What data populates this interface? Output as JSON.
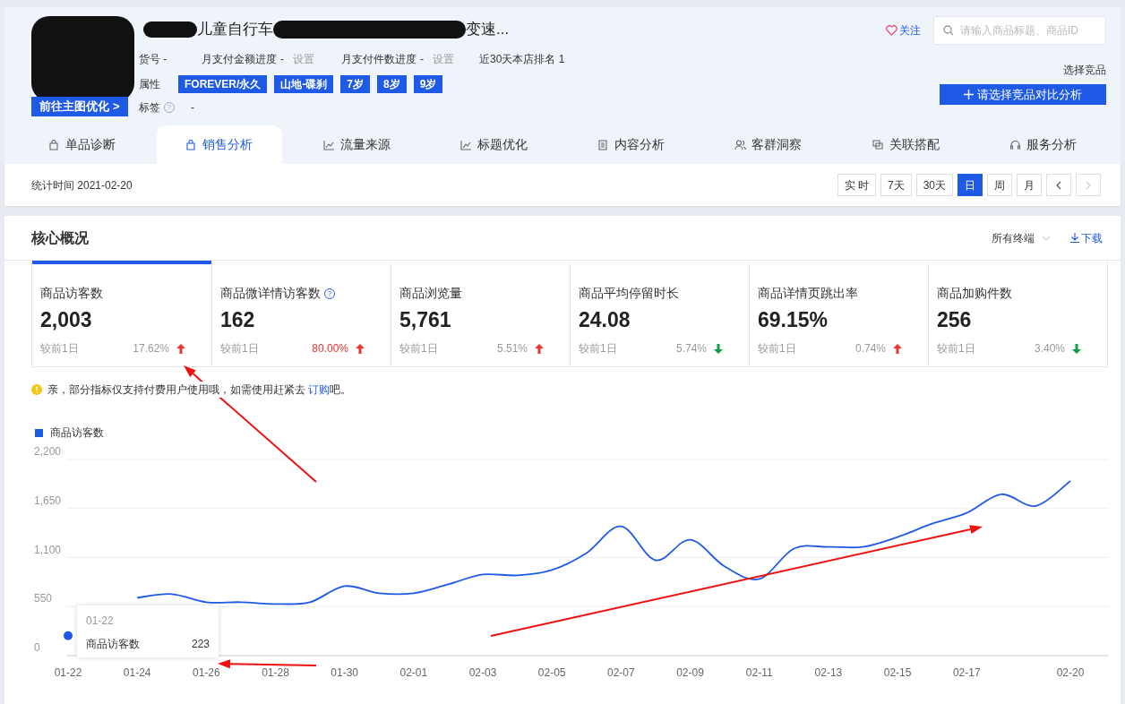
{
  "product": {
    "title_start": "儿童自行车",
    "title_end": "变速...",
    "main_image_button": "前往主图优化 >",
    "sku_label": "货号 -",
    "pay_amount_progress": "月支付金额进度",
    "pay_amount_value": "-",
    "pay_amount_setting": "设置",
    "pay_count_progress": "月支付件数进度",
    "pay_count_value": "-",
    "pay_count_setting": "设置",
    "rank": "近30天本店排名 1",
    "attributes_label": "属性",
    "attributes": [
      "FOREVER/永久",
      "山地-碟刹",
      "7岁",
      "8岁",
      "9岁"
    ],
    "tags_label": "标签",
    "tags_help": "?",
    "tags_value": "-"
  },
  "follow": "关注",
  "search": {
    "placeholder": "请输入商品标题、商品ID"
  },
  "compare": {
    "label": "选择竞品",
    "button": "请选择竞品对比分析"
  },
  "tabs": [
    {
      "label": "单品诊断",
      "selected": false
    },
    {
      "label": "销售分析",
      "selected": true
    },
    {
      "label": "流量来源",
      "selected": false
    },
    {
      "label": "标题优化",
      "selected": false
    },
    {
      "label": "内容分析",
      "selected": false
    },
    {
      "label": "客群洞察",
      "selected": false
    },
    {
      "label": "关联搭配",
      "selected": false
    },
    {
      "label": "服务分析",
      "selected": false
    }
  ],
  "stat_time": "统计时间 2021-02-20",
  "periods": [
    {
      "label": "实 时",
      "selected": false
    },
    {
      "label": "7天",
      "selected": false
    },
    {
      "label": "30天",
      "selected": false
    },
    {
      "label": "日",
      "selected": true
    },
    {
      "label": "周",
      "selected": false
    },
    {
      "label": "月",
      "selected": false
    }
  ],
  "pager": {
    "prev_disabled": false,
    "next_disabled": true
  },
  "core": {
    "title": "核心概况",
    "terminal": "所有终端",
    "download": "下载",
    "cards": [
      {
        "label": "商品访客数",
        "value": "2,003",
        "compare": "较前1日",
        "change": "17.62%",
        "rising": true,
        "highlight": false,
        "selected": true
      },
      {
        "label": "商品微详情访客数",
        "help_icon": "?",
        "value": "162",
        "compare": "较前1日",
        "change": "80.00%",
        "rising": true,
        "highlight": true,
        "selected": false
      },
      {
        "label": "商品浏览量",
        "value": "5,761",
        "compare": "较前1日",
        "change": "5.51%",
        "rising": true,
        "highlight": false,
        "selected": false
      },
      {
        "label": "商品平均停留时长",
        "value": "24.08",
        "compare": "较前1日",
        "change": "5.74%",
        "rising": false,
        "highlight": false,
        "selected": false
      },
      {
        "label": "商品详情页跳出率",
        "value": "69.15%",
        "compare": "较前1日",
        "change": "0.74%",
        "rising": true,
        "highlight": false,
        "selected": false
      },
      {
        "label": "商品加购件数",
        "value": "256",
        "compare": "较前1日",
        "change": "3.40%",
        "rising": false,
        "highlight": false,
        "selected": false
      }
    ],
    "notice": {
      "before": "亲，部分指标仅支持付费用户使用哦，如需使用赶紧去 ",
      "link": "订购",
      "after": "吧。"
    },
    "tooltip": {
      "date": "01-22",
      "name": "商品访客数",
      "value": "223"
    },
    "chart_data": {
      "type": "line",
      "categories": [
        "01-22",
        null,
        "01-24",
        null,
        "01-26",
        null,
        "01-28",
        null,
        "01-30",
        null,
        "02-01",
        null,
        "02-03",
        null,
        "02-05",
        null,
        "02-07",
        null,
        "02-09",
        null,
        "02-11",
        null,
        "02-13",
        null,
        "02-15",
        null,
        "02-17",
        null,
        null,
        "02-20"
      ],
      "series": [
        {
          "name": "商品访客数",
          "color": "#1f5ae6",
          "values": [
            223,
            null,
            650,
            690,
            600,
            600,
            580,
            600,
            780,
            700,
            700,
            800,
            910,
            900,
            960,
            1150,
            1450,
            1070,
            1300,
            1000,
            860,
            1200,
            1220,
            1220,
            1330,
            1480,
            1600,
            1810,
            1680,
            1960
          ]
        }
      ],
      "ylim": [
        0,
        2200
      ],
      "grid": true,
      "yticks": [
        {
          "value": 0,
          "label": "0"
        },
        {
          "value": 550,
          "label": "550"
        },
        {
          "value": 1100,
          "label": "1,100"
        },
        {
          "value": 1650,
          "label": "1,650"
        },
        {
          "value": 2200,
          "label": "2,200"
        }
      ]
    }
  }
}
